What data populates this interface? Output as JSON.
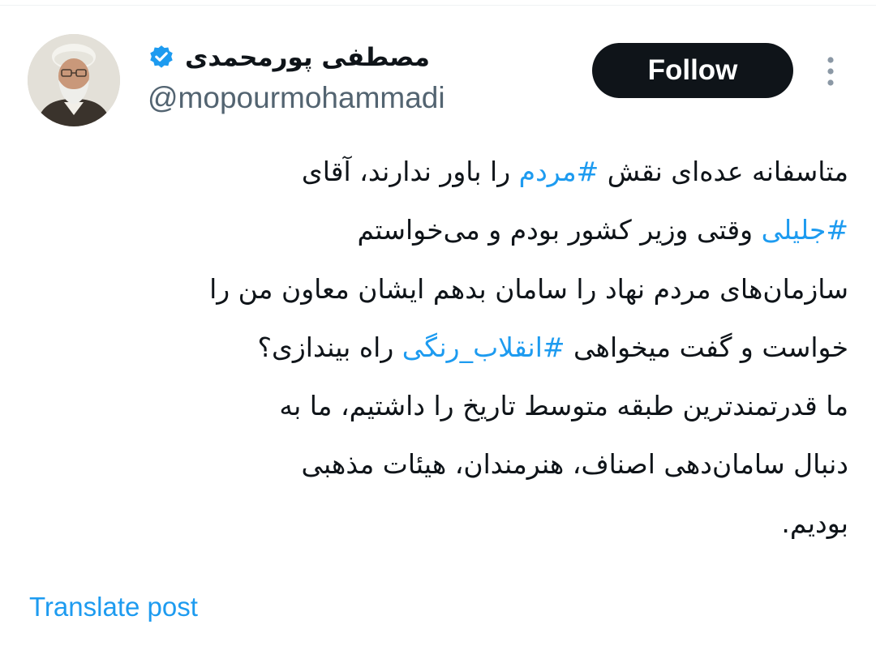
{
  "author": {
    "display_name": "مصطفی پورمحمدی",
    "handle": "@mopourmohammadi",
    "verified_icon": "verified-badge-icon",
    "avatar": "profile-photo"
  },
  "actions": {
    "follow_label": "Follow",
    "more_icon": "more-vertical-icon"
  },
  "tweet": {
    "lines": [
      [
        {
          "text": "متاسفانه عده‌ای نقش ",
          "hashtag": false
        },
        {
          "text": "#مردم",
          "hashtag": true
        },
        {
          "text": " را باور ندارند، آقای",
          "hashtag": false
        }
      ],
      [
        {
          "text": "#جلیلی",
          "hashtag": true
        },
        {
          "text": " وقتی وزیر کشور بودم و می‌خواستم",
          "hashtag": false
        }
      ],
      [
        {
          "text": "سازمان‌های مردم نهاد را سامان بدهم ایشان معاون من را",
          "hashtag": false
        }
      ],
      [
        {
          "text": "خواست و گفت میخواهی ",
          "hashtag": false
        },
        {
          "text": "#انقلاب_رنگی",
          "hashtag": true
        },
        {
          "text": " راه بیندازی؟",
          "hashtag": false
        }
      ],
      [
        {
          "text": "ما قدرتمندترین طبقه متوسط تاریخ را داشتیم، ما به",
          "hashtag": false
        }
      ],
      [
        {
          "text": "دنبال سامان‌دهی اصناف، هنرمندان، هیئات مذهبی",
          "hashtag": false
        }
      ],
      [
        {
          "text": "بودیم.",
          "hashtag": false
        }
      ]
    ]
  },
  "footer": {
    "translate_label": "Translate post"
  },
  "colors": {
    "accent": "#1d9bf0",
    "text": "#0f1419",
    "secondary_text": "#536471",
    "button_bg": "#0f1419",
    "button_text": "#ffffff"
  }
}
